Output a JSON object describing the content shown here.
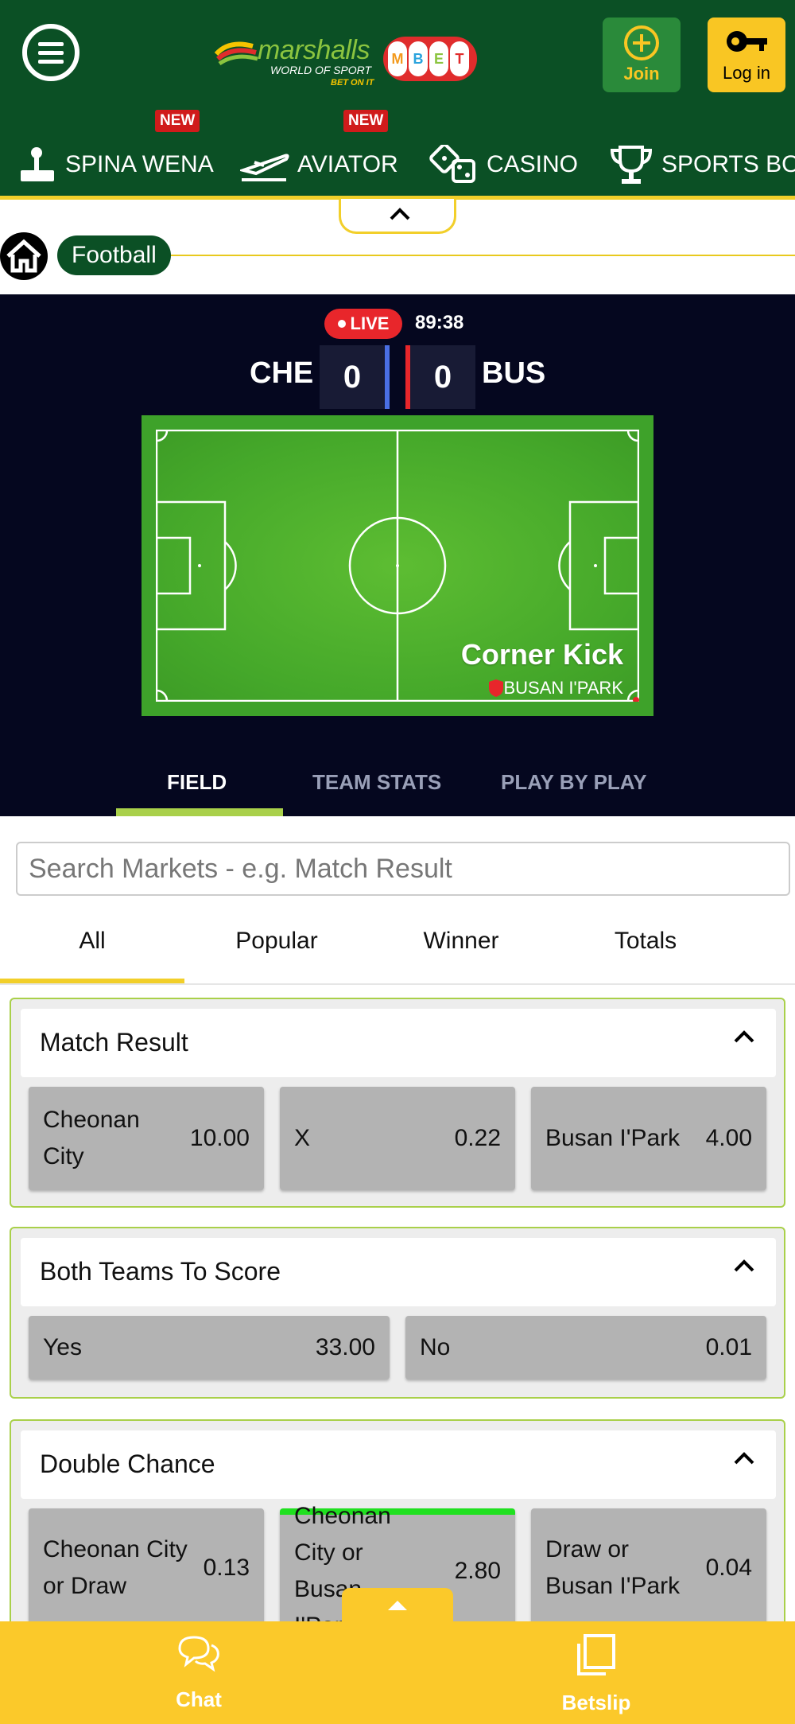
{
  "header": {
    "brand": "marshalls",
    "tagline": "WORLD OF SPORT",
    "tagline2": "BET ON IT",
    "join_label": "Join",
    "login_label": "Log in"
  },
  "nav": {
    "items": [
      {
        "label": "SPINA WENA",
        "badge": "NEW"
      },
      {
        "label": "AVIATOR",
        "badge": "NEW"
      },
      {
        "label": "CASINO",
        "badge": ""
      },
      {
        "label": "SPORTS BOO",
        "badge": ""
      }
    ]
  },
  "breadcrumb": {
    "current": "Football"
  },
  "live": {
    "badge": "LIVE",
    "clock": "89:38",
    "home_team": "CHE",
    "away_team": "BUS",
    "home_score": "0",
    "away_score": "0",
    "event_title": "Corner Kick",
    "event_team": "BUSAN I'PARK",
    "tabs": [
      "FIELD",
      "TEAM STATS",
      "PLAY BY PLAY"
    ],
    "colors": {
      "home": "#4a6fe3",
      "away": "#e8262b"
    }
  },
  "search": {
    "placeholder": "Search Markets - e.g. Match Result"
  },
  "filters": [
    "All",
    "Popular",
    "Winner",
    "Totals"
  ],
  "markets": [
    {
      "title": "Match Result",
      "odds": [
        {
          "name": "Cheonan City",
          "value": "10.00"
        },
        {
          "name": "X",
          "value": "0.22"
        },
        {
          "name": "Busan I'Park",
          "value": "4.00"
        }
      ]
    },
    {
      "title": "Both Teams To Score",
      "odds": [
        {
          "name": "Yes",
          "value": "33.00"
        },
        {
          "name": "No",
          "value": "0.01"
        }
      ]
    },
    {
      "title": "Double Chance",
      "odds": [
        {
          "name": "Cheonan City or Draw",
          "value": "0.13"
        },
        {
          "name": "Cheonan City or Busan I'Park",
          "value": "2.80"
        },
        {
          "name": "Draw or Busan I'Park",
          "value": "0.04"
        }
      ]
    }
  ],
  "footer": {
    "chat_label": "Chat",
    "betslip_label": "Betslip"
  }
}
